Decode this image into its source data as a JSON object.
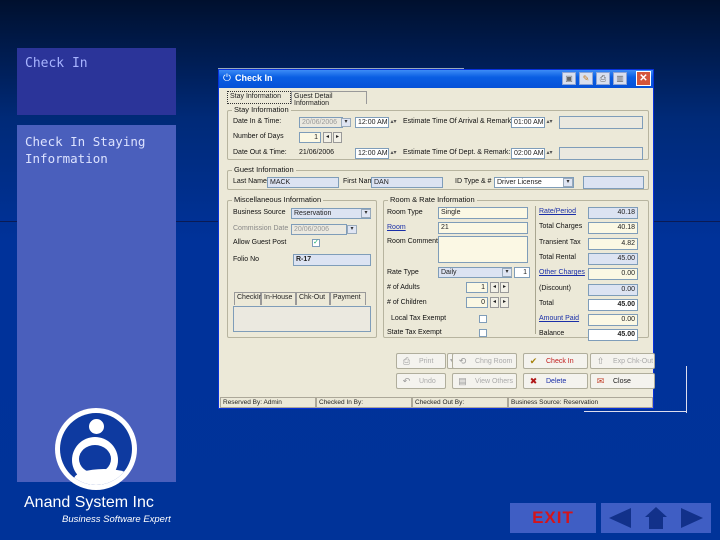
{
  "slide": {
    "title": "Check In",
    "subtitle": "Check In  Staying Information",
    "company": "Anand System Inc",
    "tagline": "Business Software Expert",
    "exit_label": "EXIT",
    "nav": {
      "prev": "previous-slide",
      "home": "home",
      "next": "next-slide"
    }
  },
  "window": {
    "title": "Check In",
    "toolbar_icons": [
      "find-icon",
      "edit-icon",
      "print-icon",
      "layout-icon"
    ],
    "close_label": "✕",
    "tabs": [
      {
        "label": "Stay Information",
        "active": true
      },
      {
        "label": "Guest Detail Information",
        "active": false
      }
    ],
    "stay": {
      "group_label": "Stay Information",
      "date_in_label": "Date In & Time:",
      "date_in_value": "20/06/2006",
      "time_in_value": "12:00 AM",
      "eta_label": "Estimate Time Of Arrival & Remark:",
      "eta_value": "01:00 AM",
      "eta_remark": "",
      "nights_label": "Number of Days",
      "nights_value": "1",
      "date_out_label": "Date Out & Time:",
      "date_out_value": "21/06/2006",
      "time_out_value": "12:00 AM",
      "etd_label": "Estimate Time Of Dept. & Remark:",
      "etd_value": "02:00 AM",
      "etd_remark": ""
    },
    "guest": {
      "group_label": "Guest Information",
      "last_name_label": "Last Name",
      "last_name_value": "MACK",
      "first_name_label": "First Name",
      "first_name_value": "DAN",
      "id_type_label": "ID Type & #",
      "id_type_value": "Driver License",
      "id_number_value": ""
    },
    "misc": {
      "group_label": "Miscellaneous Information",
      "business_source_label": "Business Source",
      "business_source_value": "Reservation",
      "commission_label": "Commission Date",
      "commission_value": "20/06/2006",
      "allow_guest_label": "Allow Guest Post",
      "allow_guest_checked": true,
      "folio_label": "Folio No",
      "folio_value": "R-17",
      "subtabs": [
        "CheckIn",
        "In-House",
        "Chk-Out",
        "Payment"
      ]
    },
    "room": {
      "group_label": "Room & Rate Information",
      "room_type_label": "Room Type",
      "room_type_value": "Single",
      "room_label": "Room",
      "room_value": "21",
      "comment_label": "Room Comment",
      "comment_value": "",
      "rate_type_label": "Rate Type",
      "rate_type_value": "Daily",
      "rate_qty": "1",
      "adults_label": "# of Adults",
      "adults_value": "1",
      "children_label": "# of Children",
      "children_value": "0",
      "local_tax_label": "Local Tax Exempt",
      "local_tax_checked": false,
      "state_tax_label": "State Tax Exempt",
      "state_tax_checked": false
    },
    "charges": [
      {
        "label": "Rate/Period",
        "value": "40.18",
        "link": true,
        "style": "blue"
      },
      {
        "label": "Total Charges",
        "value": "40.18",
        "link": false,
        "style": "cream"
      },
      {
        "label": "Transient Tax",
        "value": "4.82",
        "link": false,
        "style": "cream"
      },
      {
        "label": "Total Rental",
        "value": "45.00",
        "link": false,
        "style": "blue"
      },
      {
        "label": "Other Charges",
        "value": "0.00",
        "link": true,
        "style": "cream"
      },
      {
        "label": "(Discount)",
        "value": "0.00",
        "link": false,
        "style": "blue"
      },
      {
        "label": "Total",
        "value": "45.00",
        "link": false,
        "style": "white"
      },
      {
        "label": "Amount Paid",
        "value": "0.00",
        "link": true,
        "style": "cream"
      },
      {
        "label": "Balance",
        "value": "45.00",
        "link": false,
        "style": "white"
      }
    ],
    "buttons": [
      {
        "label": "Print",
        "icon": "printer-icon",
        "state": "disabled"
      },
      {
        "label": "Chng Room",
        "icon": "change-room-icon",
        "state": "disabled"
      },
      {
        "label": "Check In",
        "icon": "check-in-icon",
        "state": "active"
      },
      {
        "label": "Exp Chk-Out",
        "icon": "express-checkout-icon",
        "state": "disabled"
      },
      {
        "label": "Undo",
        "icon": "undo-icon",
        "state": "disabled"
      },
      {
        "label": "View Others",
        "icon": "view-others-icon",
        "state": "disabled"
      },
      {
        "label": "Delete",
        "icon": "delete-icon",
        "state": "blue"
      },
      {
        "label": "Close",
        "icon": "close-door-icon",
        "state": "dark"
      }
    ],
    "status": [
      "Reserved By: Admin",
      "Checked In By:",
      "Checked Out By:",
      "Business Source: Reservation"
    ]
  }
}
